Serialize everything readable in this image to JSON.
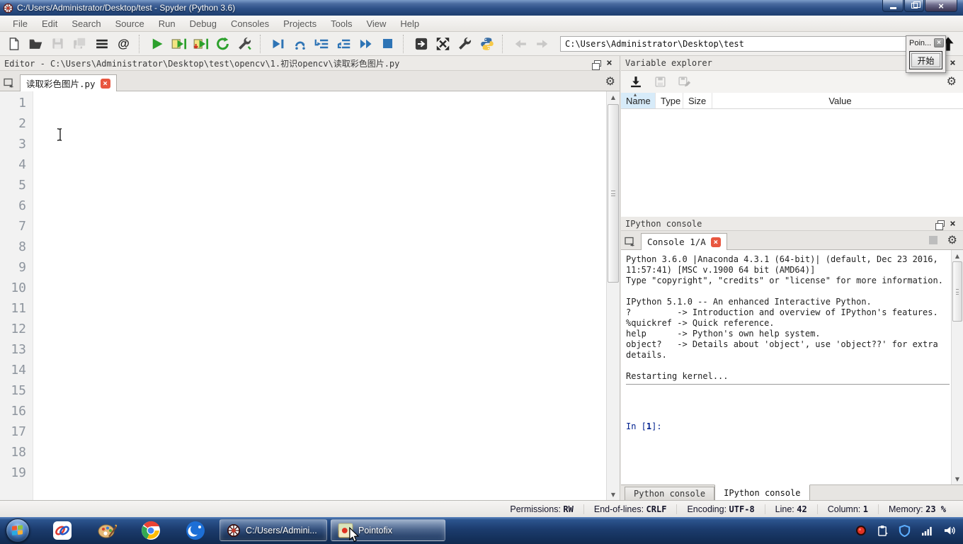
{
  "window": {
    "title": "C:/Users/Administrator/Desktop/test - Spyder (Python 3.6)"
  },
  "menu": {
    "items": [
      "File",
      "Edit",
      "Search",
      "Source",
      "Run",
      "Debug",
      "Consoles",
      "Projects",
      "Tools",
      "View",
      "Help"
    ]
  },
  "toolbar": {
    "address": "C:\\Users\\Administrator\\Desktop\\test"
  },
  "pointofix": {
    "title": "Poin...",
    "start_label": "开始"
  },
  "editor": {
    "pane_title": "Editor - C:\\Users\\Administrator\\Desktop\\test\\opencv\\1.初识opencv\\读取彩色图片.py",
    "tab_label": "读取彩色图片.py",
    "line_numbers": [
      "1",
      "2",
      "3",
      "4",
      "5",
      "6",
      "7",
      "8",
      "9",
      "10",
      "11",
      "12",
      "13",
      "14",
      "15",
      "16",
      "17",
      "18",
      "19"
    ]
  },
  "varexp": {
    "pane_title": "Variable explorer",
    "columns": [
      "Name",
      "Type",
      "Size",
      "Value"
    ]
  },
  "console": {
    "pane_title": "IPython console",
    "tab_label": "Console 1/A",
    "lines": [
      "Python 3.6.0 |Anaconda 4.3.1 (64-bit)| (default, Dec 23 2016,",
      "11:57:41) [MSC v.1900 64 bit (AMD64)]",
      "Type \"copyright\", \"credits\" or \"license\" for more information.",
      "",
      "IPython 5.1.0 -- An enhanced Interactive Python.",
      "?         -> Introduction and overview of IPython's features.",
      "%quickref -> Quick reference.",
      "help      -> Python's own help system.",
      "object?   -> Details about 'object', use 'object??' for extra",
      "details.",
      "",
      "Restarting kernel..."
    ],
    "prompt": {
      "pre": "In [",
      "num": "1",
      "post": "]:"
    },
    "bottom_tabs": [
      "Python console",
      "IPython console"
    ]
  },
  "statusbar": {
    "items": [
      {
        "label": "Permissions:",
        "value": "RW"
      },
      {
        "label": "End-of-lines:",
        "value": "CRLF"
      },
      {
        "label": "Encoding:",
        "value": "UTF-8"
      },
      {
        "label": "Line:",
        "value": "42"
      },
      {
        "label": "Column:",
        "value": "1"
      },
      {
        "label": "Memory:",
        "value": "23 %"
      }
    ]
  },
  "taskbar": {
    "buttons": [
      {
        "label": "C:/Users/Admini..."
      },
      {
        "label": "Pointofix"
      }
    ]
  },
  "icons": {
    "gear": "⚙",
    "close": "×",
    "at": "@",
    "sort_asc": "▴",
    "scroll_up": "▲",
    "scroll_down": "▼"
  },
  "colors": {
    "run_green": "#2ca02c",
    "debug_blue": "#2e74b5",
    "tab_close_red": "#e8563f",
    "prompt_navy": "#00218f",
    "titlebar_blue": "#2d5188",
    "taskbar_blue": "#1c3c6e"
  }
}
